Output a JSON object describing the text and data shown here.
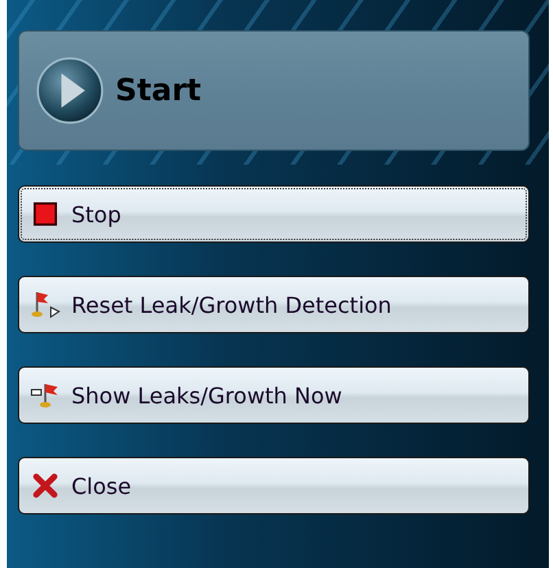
{
  "start_button": {
    "label": "Start"
  },
  "buttons": [
    {
      "kind": "stop",
      "label": "Stop",
      "focused": true
    },
    {
      "kind": "reset",
      "label": "Reset Leak/Growth Detection",
      "focused": false
    },
    {
      "kind": "show",
      "label": "Show Leaks/Growth Now",
      "focused": false
    },
    {
      "kind": "close",
      "label": "Close",
      "focused": false
    }
  ]
}
